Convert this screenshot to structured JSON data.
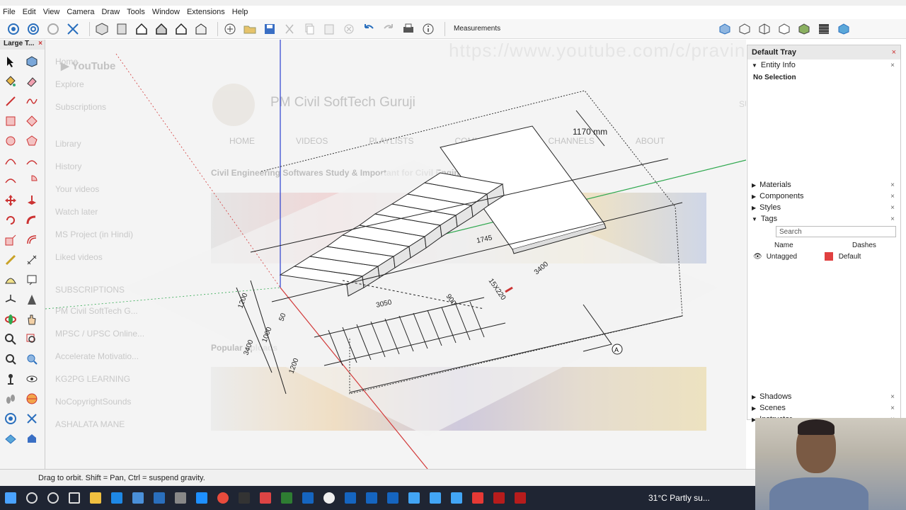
{
  "menu": [
    "File",
    "Edit",
    "View",
    "Camera",
    "Draw",
    "Tools",
    "Window",
    "Extensions",
    "Help"
  ],
  "toolbar": {
    "measurements_label": "Measurements"
  },
  "left_tray_title": "Large T...",
  "viewport": {
    "background_url": "https://www.youtube.com/c/pravinmane",
    "youtube_channel": "PM Civil SoftTech Guruji",
    "youtube_subscribed": "SUBSCRIBED",
    "youtube_tabs": [
      "HOME",
      "VIDEOS",
      "PLAYLISTS",
      "COMMUNITY",
      "CHANNELS",
      "ABOUT"
    ],
    "youtube_nav": [
      "Home",
      "Explore",
      "Subscriptions",
      "Library",
      "History",
      "Your videos",
      "Watch later",
      "MS Project (in Hindi)",
      "Liked videos",
      "SUBSCRIPTIONS",
      "PM Civil SoftTech G...",
      "MPSC / UPSC Online...",
      "Accelerate Motivatio...",
      "KG2PG LEARNING",
      "NoCopyrightSounds",
      "ASHALATA MANE"
    ],
    "youtube_playlist_title": "Civil Engineering Softwares Study & Important for Civil Engineers",
    "youtube_popular": "Popular uploads",
    "dimension_1170": "1170 mm",
    "dim_1745": "1745",
    "dim_3050": "3050",
    "dim_900": "900",
    "dim_3400": "3400",
    "dim_1200": "1200",
    "dim_1000": "1000",
    "dim_50": "50",
    "dim_3400b": "3400",
    "dim_1200b": "1200",
    "dim_15x": "15X220"
  },
  "status": {
    "hint": "Drag to orbit. Shift = Pan, Ctrl = suspend gravity."
  },
  "tray": {
    "title": "Default Tray",
    "entity_info": "Entity Info",
    "no_selection": "No Selection",
    "sections": [
      "Materials",
      "Components",
      "Styles",
      "Tags"
    ],
    "search_placeholder": "Search",
    "col_name": "Name",
    "col_dashes": "Dashes",
    "tag_name": "Untagged",
    "tag_dashes": "Default",
    "tag_color": "#e04040",
    "bottom_sections": [
      "Shadows",
      "Scenes",
      "Instructor"
    ]
  },
  "taskbar": {
    "weather": "31°C  Partly su..."
  },
  "colors": {
    "red_axis": "#d23a3a",
    "green_axis": "#2fa84f",
    "blue_axis": "#2b3fcf"
  }
}
